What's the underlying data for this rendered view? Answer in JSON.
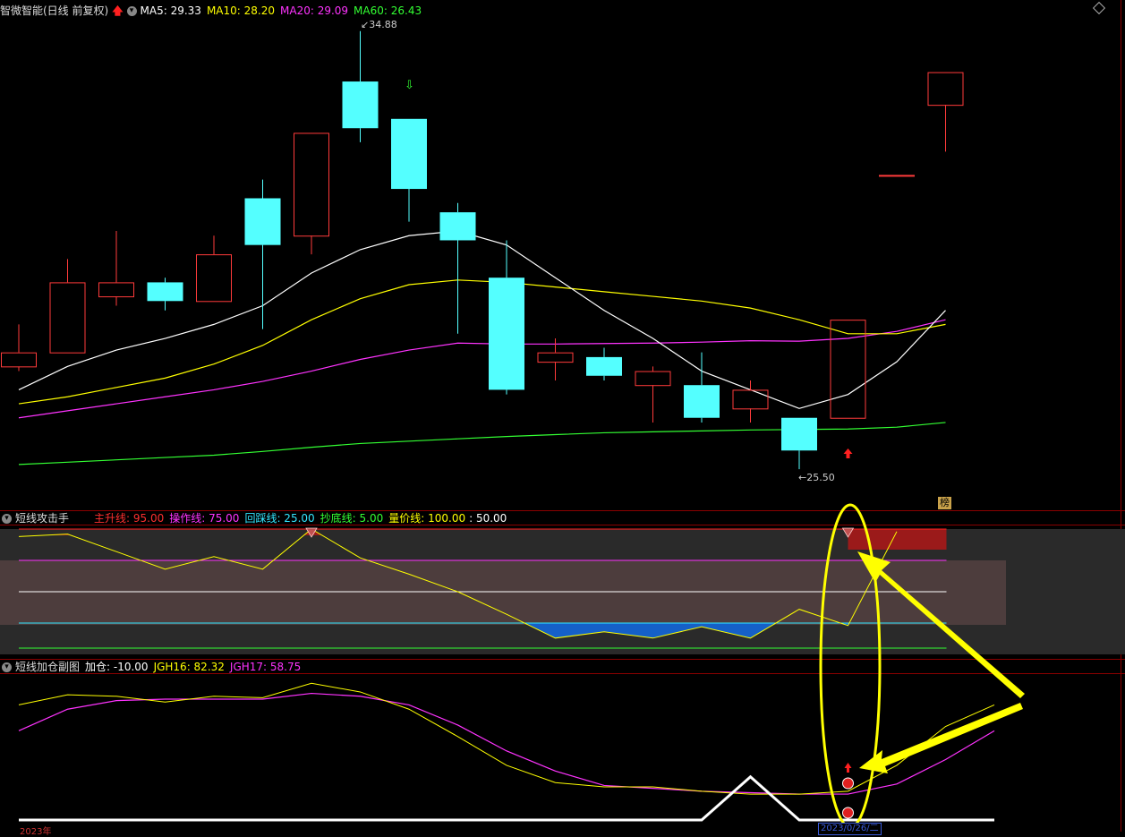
{
  "main_header": {
    "title": "智微智能(日线 前复权)",
    "ma5": "MA5: 29.33",
    "ma10": "MA10: 28.20",
    "ma20": "MA20: 29.09",
    "ma60": "MA60: 26.43"
  },
  "ind1_header": {
    "title": "短线攻击手",
    "main_up": "主升线: 95.00",
    "operate": "操作线: 75.00",
    "pullback": "回踩线: 25.00",
    "bottom": "抄底线: 5.00",
    "volume_price": "量价线: 100.00",
    "mid": ": 50.00"
  },
  "ind2_header": {
    "title": "短线加仓副图",
    "add_pos": "加仓: -10.00",
    "jgh16": "JGH16: 82.32",
    "jgh17": "JGH17: 58.75"
  },
  "labels": {
    "high_price": "34.88",
    "low_price": "25.50",
    "rank_badge": "榜",
    "date_box": "2023/0/26/二",
    "year": "2023年"
  },
  "colors": {
    "up": "#ff3b3b",
    "down": "#54ffff",
    "ma5": "#ffffff",
    "ma10": "#ffff00",
    "ma20": "#ff33ff",
    "ma60": "#33ff33",
    "ann": "#ffff00"
  },
  "chart_data": {
    "type": "candlestick",
    "candles": [
      {
        "o": 27.7,
        "c": 28.0,
        "h": 28.6,
        "l": 27.6
      },
      {
        "o": 28.0,
        "c": 29.5,
        "h": 30.0,
        "l": 28.0
      },
      {
        "o": 29.2,
        "c": 29.5,
        "h": 30.6,
        "l": 29.0
      },
      {
        "o": 29.5,
        "c": 29.1,
        "h": 29.6,
        "l": 28.9
      },
      {
        "o": 29.1,
        "c": 30.1,
        "h": 30.5,
        "l": 29.1
      },
      {
        "o": 31.3,
        "c": 30.3,
        "h": 31.7,
        "l": 28.5
      },
      {
        "o": 30.5,
        "c": 32.7,
        "h": 32.7,
        "l": 30.1
      },
      {
        "o": 33.8,
        "c": 32.8,
        "h": 34.88,
        "l": 32.5
      },
      {
        "o": 33.0,
        "c": 31.5,
        "h": 33.0,
        "l": 30.8
      },
      {
        "o": 31.0,
        "c": 30.4,
        "h": 31.2,
        "l": 28.4
      },
      {
        "o": 29.6,
        "c": 27.2,
        "h": 30.4,
        "l": 27.1
      },
      {
        "o": 27.8,
        "c": 28.0,
        "h": 28.3,
        "l": 27.4
      },
      {
        "o": 27.9,
        "c": 27.5,
        "h": 28.1,
        "l": 27.4
      },
      {
        "o": 27.3,
        "c": 27.6,
        "h": 27.7,
        "l": 26.5
      },
      {
        "o": 27.3,
        "c": 26.6,
        "h": 28.0,
        "l": 26.5
      },
      {
        "o": 26.8,
        "c": 27.2,
        "h": 27.4,
        "l": 26.5
      },
      {
        "o": 26.6,
        "c": 25.9,
        "h": 26.6,
        "l": 25.5
      },
      {
        "o": 26.6,
        "c": 28.7,
        "h": 28.7,
        "l": 26.6
      },
      {
        "o": 31.8,
        "c": 31.8,
        "h": 31.8,
        "l": 31.8
      },
      {
        "o": 33.3,
        "c": 34.0,
        "h": 34.0,
        "l": 32.3
      }
    ],
    "ma5": [
      27.2,
      27.7,
      28.05,
      28.3,
      28.6,
      29.0,
      29.7,
      30.2,
      30.5,
      30.6,
      30.3,
      29.6,
      28.9,
      28.3,
      27.6,
      27.2,
      26.8,
      27.1,
      27.8,
      28.9
    ],
    "ma10": [
      26.9,
      27.05,
      27.25,
      27.45,
      27.75,
      28.15,
      28.7,
      29.15,
      29.45,
      29.55,
      29.5,
      29.4,
      29.3,
      29.2,
      29.1,
      28.95,
      28.7,
      28.4,
      28.4,
      28.6
    ],
    "ma20": [
      26.6,
      26.75,
      26.9,
      27.05,
      27.2,
      27.38,
      27.6,
      27.85,
      28.05,
      28.2,
      28.18,
      28.18,
      28.19,
      28.2,
      28.22,
      28.25,
      28.24,
      28.3,
      28.45,
      28.7
    ],
    "ma60": [
      25.6,
      25.65,
      25.7,
      25.75,
      25.8,
      25.88,
      25.97,
      26.05,
      26.1,
      26.15,
      26.2,
      26.24,
      26.28,
      26.3,
      26.32,
      26.34,
      26.35,
      26.36,
      26.4,
      26.5
    ],
    "ylim": [
      25.1,
      35.2
    ],
    "ind1": [
      94,
      96,
      82,
      68,
      78,
      68,
      100,
      77,
      64,
      50,
      32,
      13,
      18,
      13,
      22,
      13,
      36,
      23,
      98
    ],
    "ind1_levels": {
      "top": 100,
      "main_up": 95,
      "operate": 75,
      "mid": 50,
      "pullback": 25,
      "bottom": 5
    },
    "ind2_jgh16": [
      80,
      87,
      86,
      82,
      86,
      85,
      95,
      89,
      77,
      58,
      38,
      26,
      23,
      23,
      20,
      18,
      18,
      20,
      38,
      65,
      80
    ],
    "ind2_jgh17": [
      62,
      77,
      83,
      84,
      84,
      84,
      88,
      86,
      80,
      66,
      48,
      34,
      24,
      22,
      20,
      19,
      18,
      18,
      25,
      42,
      62
    ],
    "ind2_base": [
      0,
      0,
      0,
      0,
      0,
      0,
      0,
      0,
      0,
      0,
      0,
      0,
      0,
      0,
      0,
      30,
      0,
      0,
      0,
      0,
      0
    ]
  }
}
